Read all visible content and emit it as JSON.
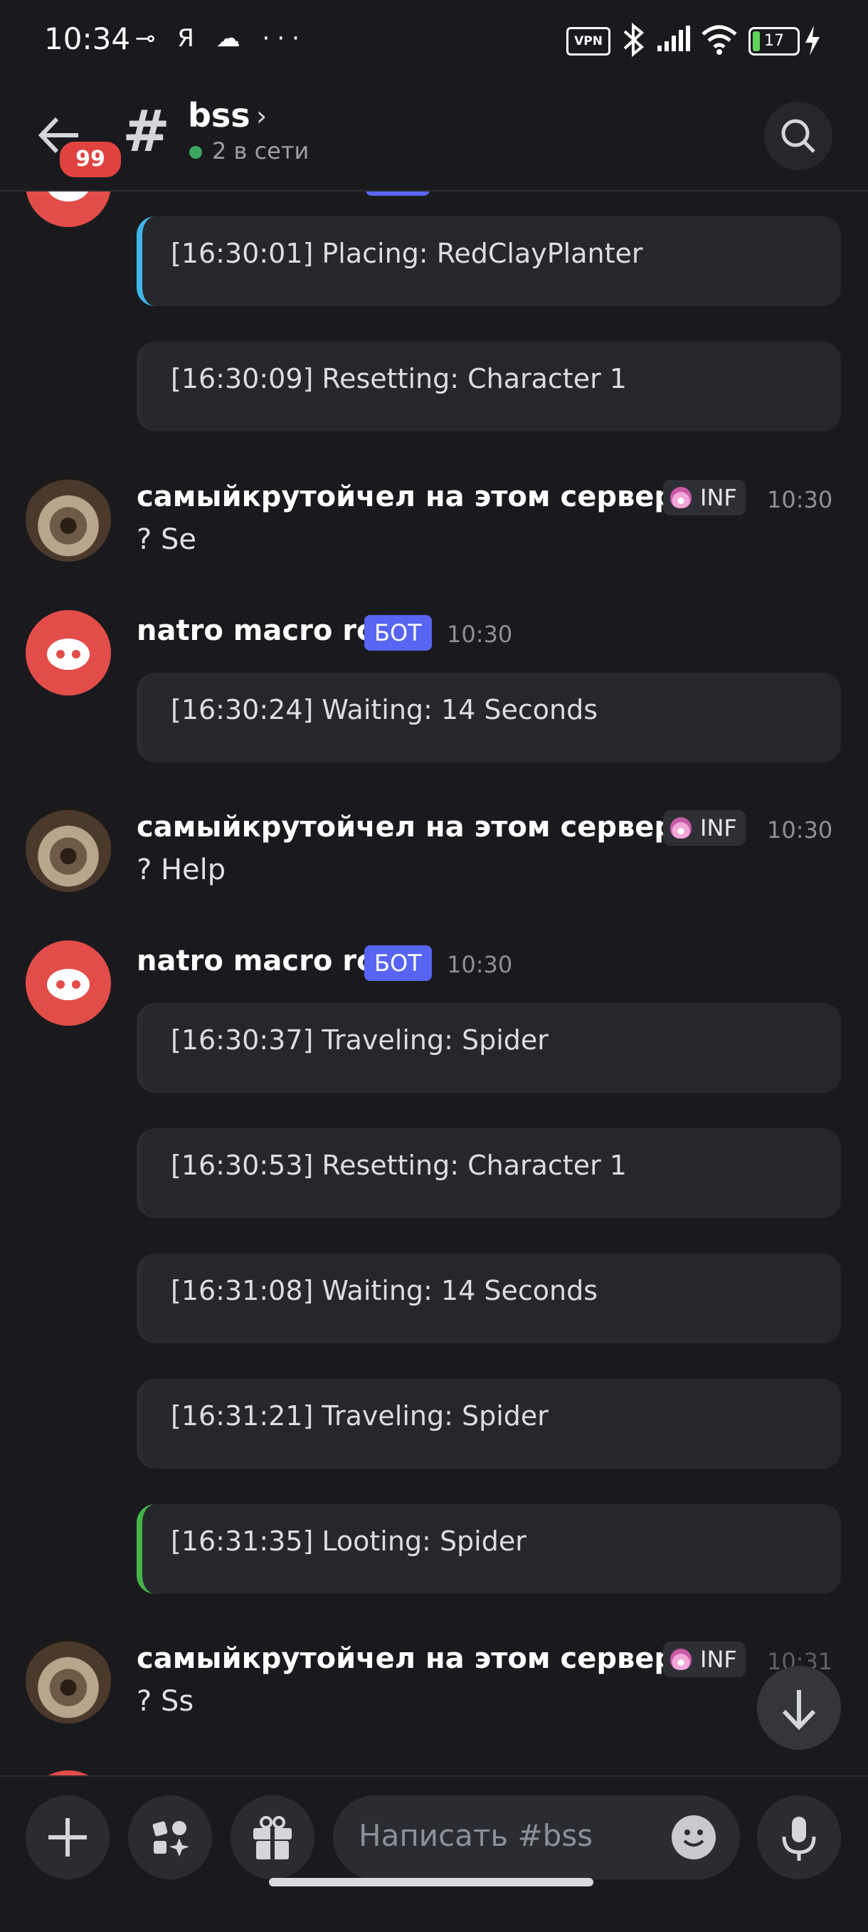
{
  "status_bar": {
    "time": "10:34",
    "left_icons": "⊸ Я ☁ ···",
    "vpn_label": "VPN",
    "battery_level": "17"
  },
  "header": {
    "back_badge": "99",
    "channel_name": "bss",
    "online_status": "2 в сети"
  },
  "colors": {
    "background": "#1a1a1e",
    "bot_avatar": "#e34d49",
    "bot_badge": "#5865f2",
    "online": "#3ba55d",
    "embed_blue": "#3fb6e8",
    "embed_green": "#45b349"
  },
  "messages": [
    {
      "embeds": [
        "[16:30:01] Placing: RedClayPlanter",
        "[16:30:09] Resetting: Character 1"
      ]
    },
    {
      "author": "самыйкрутойчел на этом сервере",
      "role": "INF",
      "time": "10:30",
      "text": "? Se"
    },
    {
      "author": "natro macro rc",
      "badge": "БОТ",
      "time": "10:30",
      "embeds": [
        "[16:30:24] Waiting: 14 Seconds"
      ]
    },
    {
      "author": "самыйкрутойчел на этом сервере",
      "role": "INF",
      "time": "10:30",
      "text": "? Help"
    },
    {
      "author": "natro macro rc",
      "badge": "БОТ",
      "time": "10:30",
      "embeds": [
        "[16:30:37] Traveling: Spider",
        "[16:30:53] Resetting: Character 1",
        "[16:31:08] Waiting: 14 Seconds",
        "[16:31:21] Traveling: Spider",
        "[16:31:35] Looting: Spider"
      ]
    },
    {
      "author": "самыйкрутойчел на этом сервере",
      "role": "INF",
      "time": "10:31",
      "text": "? Ss"
    }
  ],
  "composer": {
    "placeholder": "Написать #bss",
    "icons": [
      "plus-icon",
      "apps-icon",
      "gift-icon",
      "emoji-icon",
      "microphone-icon"
    ]
  }
}
